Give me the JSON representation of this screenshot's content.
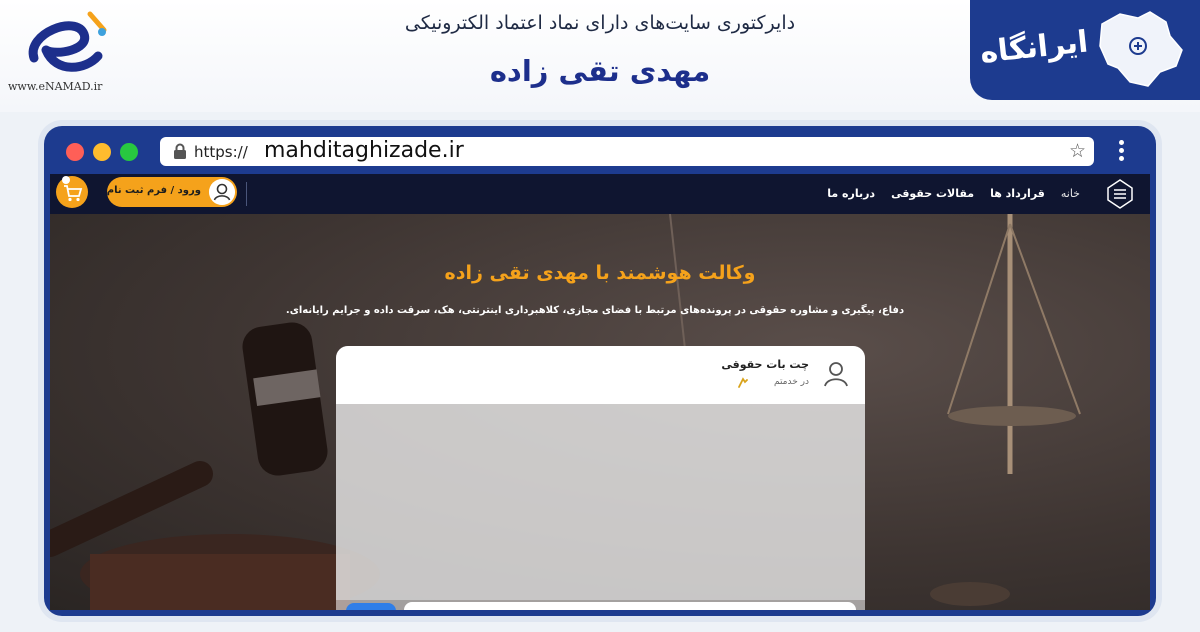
{
  "banner": {
    "directory_title": "دایرکتوری سایت‌های دارای نماد اعتماد الکترونیکی",
    "site_name": "مهدی تقی زاده",
    "enamad_url": "www.eNAMAD.ir",
    "irangah_logo": "ایرانگاه"
  },
  "browser": {
    "url_prefix": "https://",
    "url_domain": "mahditaghizade.ir",
    "icons": [
      "lock-icon",
      "star-icon",
      "kebab-menu-icon"
    ],
    "traffic_light_colors": [
      "#ff5f57",
      "#febc2e",
      "#28c840"
    ]
  },
  "site": {
    "nav": {
      "home": "خانه",
      "contracts": "قرارداد ها",
      "articles": "مقالات حقوقی",
      "about": "درباره ما"
    },
    "login_label": "ورود / فرم ثبت نام",
    "hero": {
      "title": "وکالت هوشمند با مهدی تقی زاده",
      "subtitle": "دفاع، پیگیری و مشاوره حقوقی در پرونده‌های مرتبط با فضای مجازی، کلاهبرداری اینترنتی، هک، سرقت داده و جرایم رایانه‌ای."
    },
    "chat": {
      "title": "چت بات حقوقی",
      "status": "در خدمتم"
    },
    "colors": {
      "accent": "#f5a21b",
      "navbar": "#0f1530",
      "frame": "#1d3b8f",
      "send_button": "#2f7ee8"
    }
  }
}
